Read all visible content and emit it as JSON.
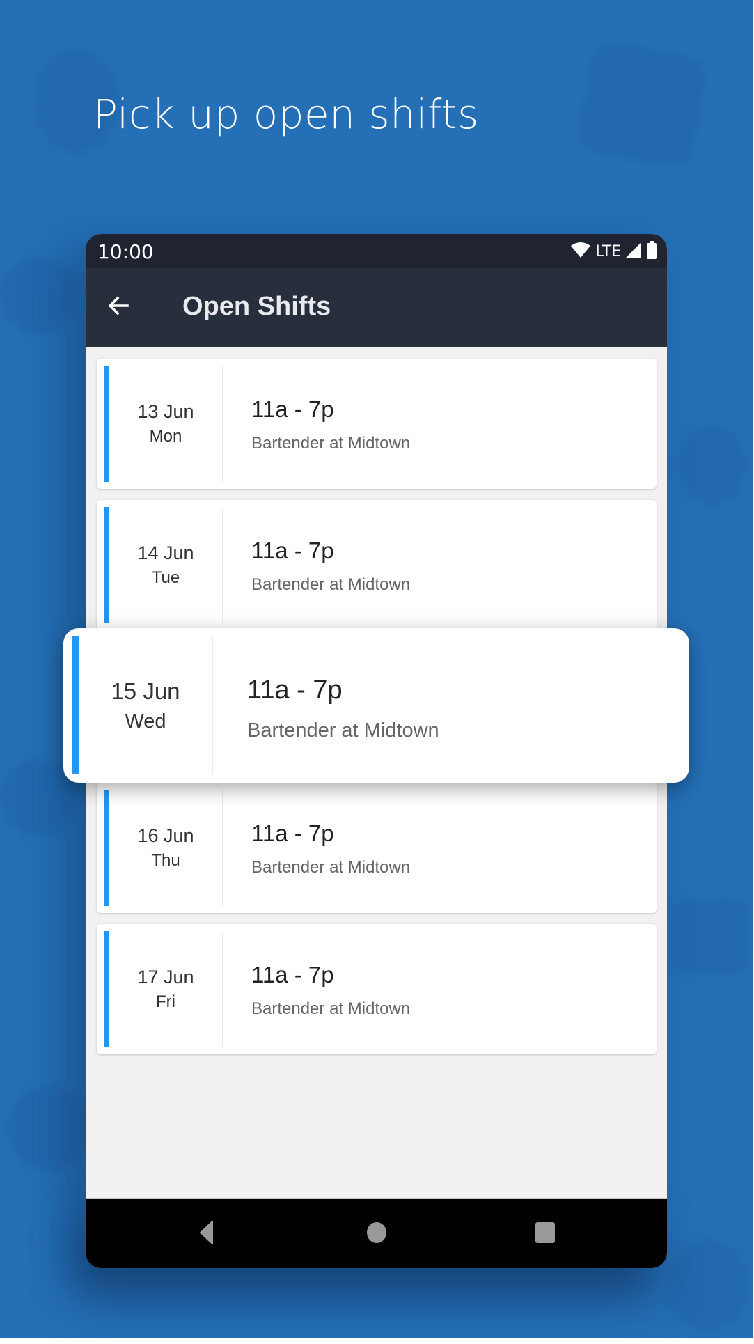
{
  "headline": "Pick up open shifts",
  "colors": {
    "background": "#246fb6",
    "accent": "#2196f3",
    "status_bar": "#1f2430",
    "app_bar": "#272f3d"
  },
  "status_bar": {
    "time": "10:00",
    "network_label": "LTE",
    "icons": [
      "wifi-icon",
      "signal-icon",
      "battery-icon"
    ]
  },
  "app_bar": {
    "back_icon": "arrow-left-icon",
    "title": "Open Shifts"
  },
  "shifts": [
    {
      "date": "13 Jun",
      "day": "Mon",
      "time": "11a - 7p",
      "role": "Bartender at Midtown"
    },
    {
      "date": "14 Jun",
      "day": "Tue",
      "time": "11a - 7p",
      "role": "Bartender at Midtown"
    },
    {
      "date": "15 Jun",
      "day": "Wed",
      "time": "11a - 7p",
      "role": "Bartender at Midtown",
      "highlighted": true
    },
    {
      "date": "16 Jun",
      "day": "Thu",
      "time": "11a - 7p",
      "role": "Bartender at Midtown"
    },
    {
      "date": "17 Jun",
      "day": "Fri",
      "time": "11a - 7p",
      "role": "Bartender at Midtown"
    }
  ],
  "nav_bar": {
    "buttons": [
      "back-triangle-icon",
      "home-circle-icon",
      "recents-square-icon"
    ]
  }
}
